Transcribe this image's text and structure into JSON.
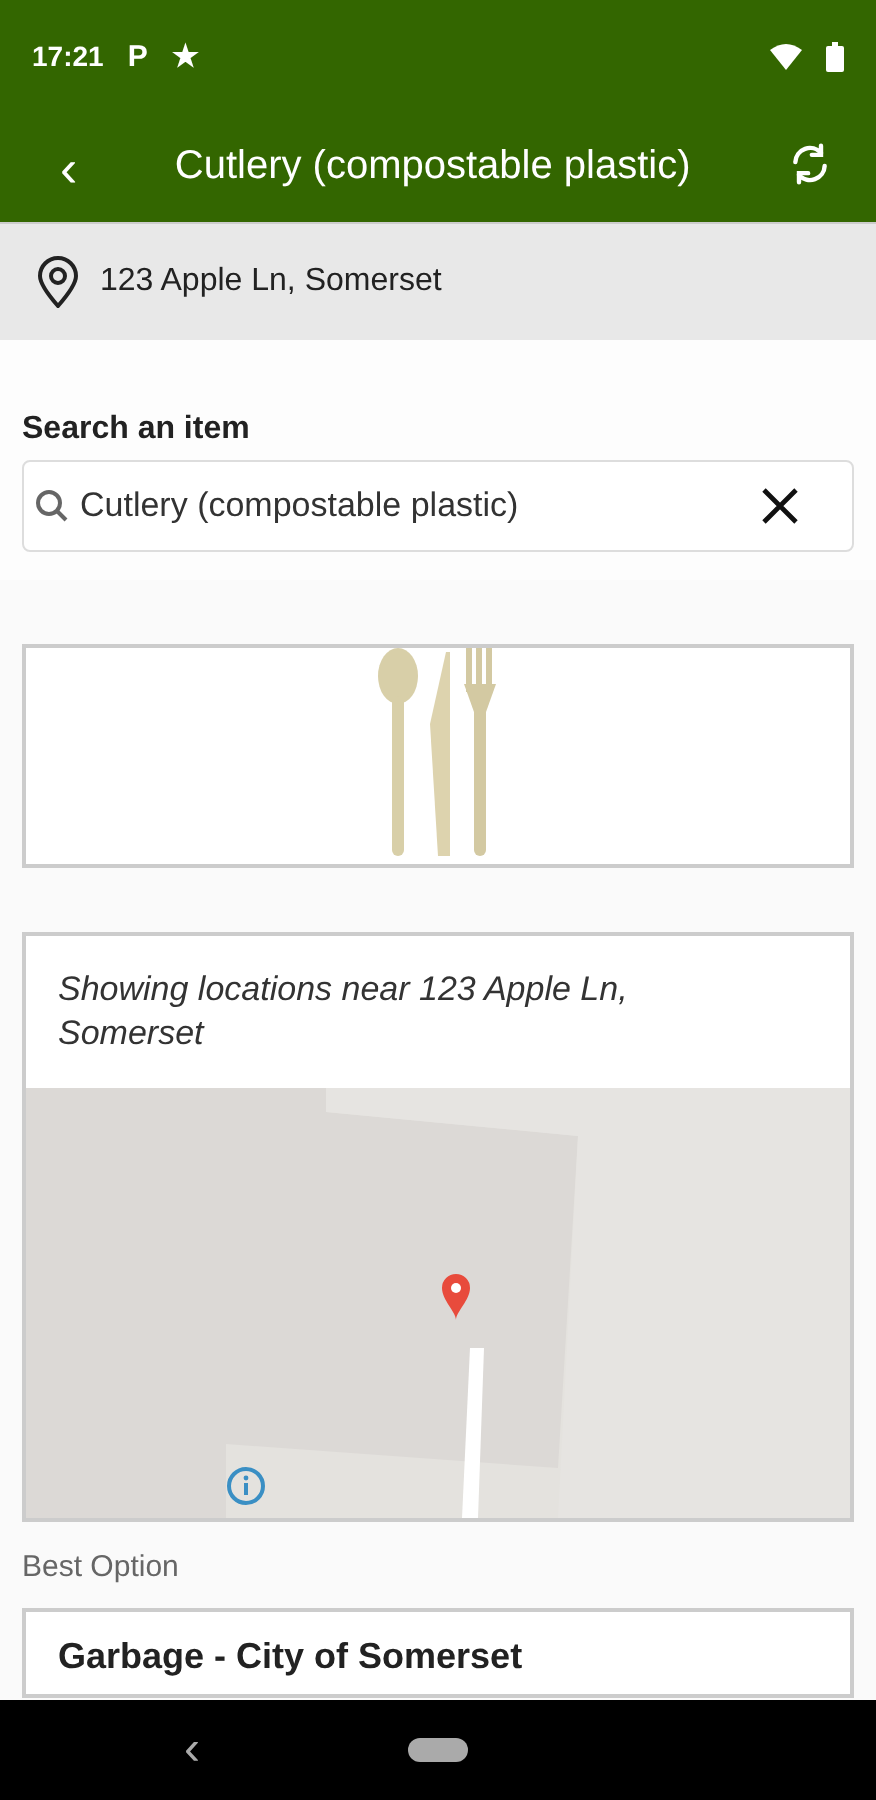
{
  "status_bar": {
    "time": "17:21",
    "notifications": [
      "P",
      "★"
    ]
  },
  "app_bar": {
    "back": "‹",
    "title": "Cutlery (compostable plastic)"
  },
  "location": {
    "address": "123 Apple Ln, Somerset"
  },
  "search": {
    "label": "Search an item",
    "value": "Cutlery (compostable plastic)"
  },
  "map_card": {
    "caption": "Showing locations near 123 Apple Ln, Somerset"
  },
  "best_option": {
    "heading": "Best Option",
    "title": "Garbage - City of Somerset"
  },
  "nav_bar": {
    "back": "‹"
  }
}
